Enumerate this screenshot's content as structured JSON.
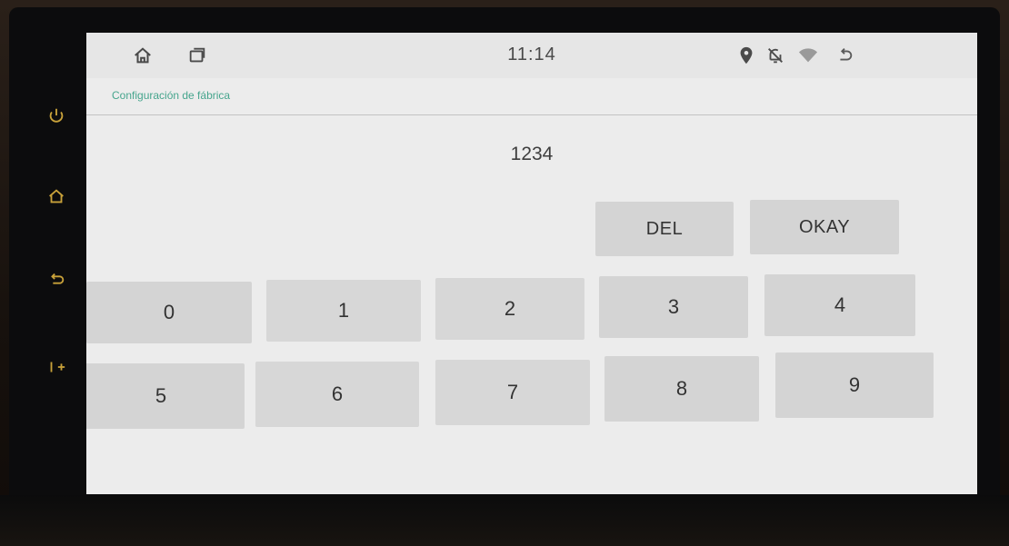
{
  "statusbar": {
    "time": "11:14",
    "icons": [
      "home-icon",
      "recent-apps-icon",
      "location-icon",
      "notifications-off-icon",
      "wifi-icon",
      "back-icon"
    ]
  },
  "title": "Configuración de fábrica",
  "display": "1234",
  "actions": {
    "del": "DEL",
    "okay": "OKAY"
  },
  "keys": {
    "row1": [
      "0",
      "1",
      "2",
      "3",
      "4"
    ],
    "row2": [
      "5",
      "6",
      "7",
      "8",
      "9"
    ]
  },
  "colors": {
    "title_accent": "#46a58d",
    "screen_bg": "#ececec",
    "key_bg": "#d4d4d4"
  }
}
